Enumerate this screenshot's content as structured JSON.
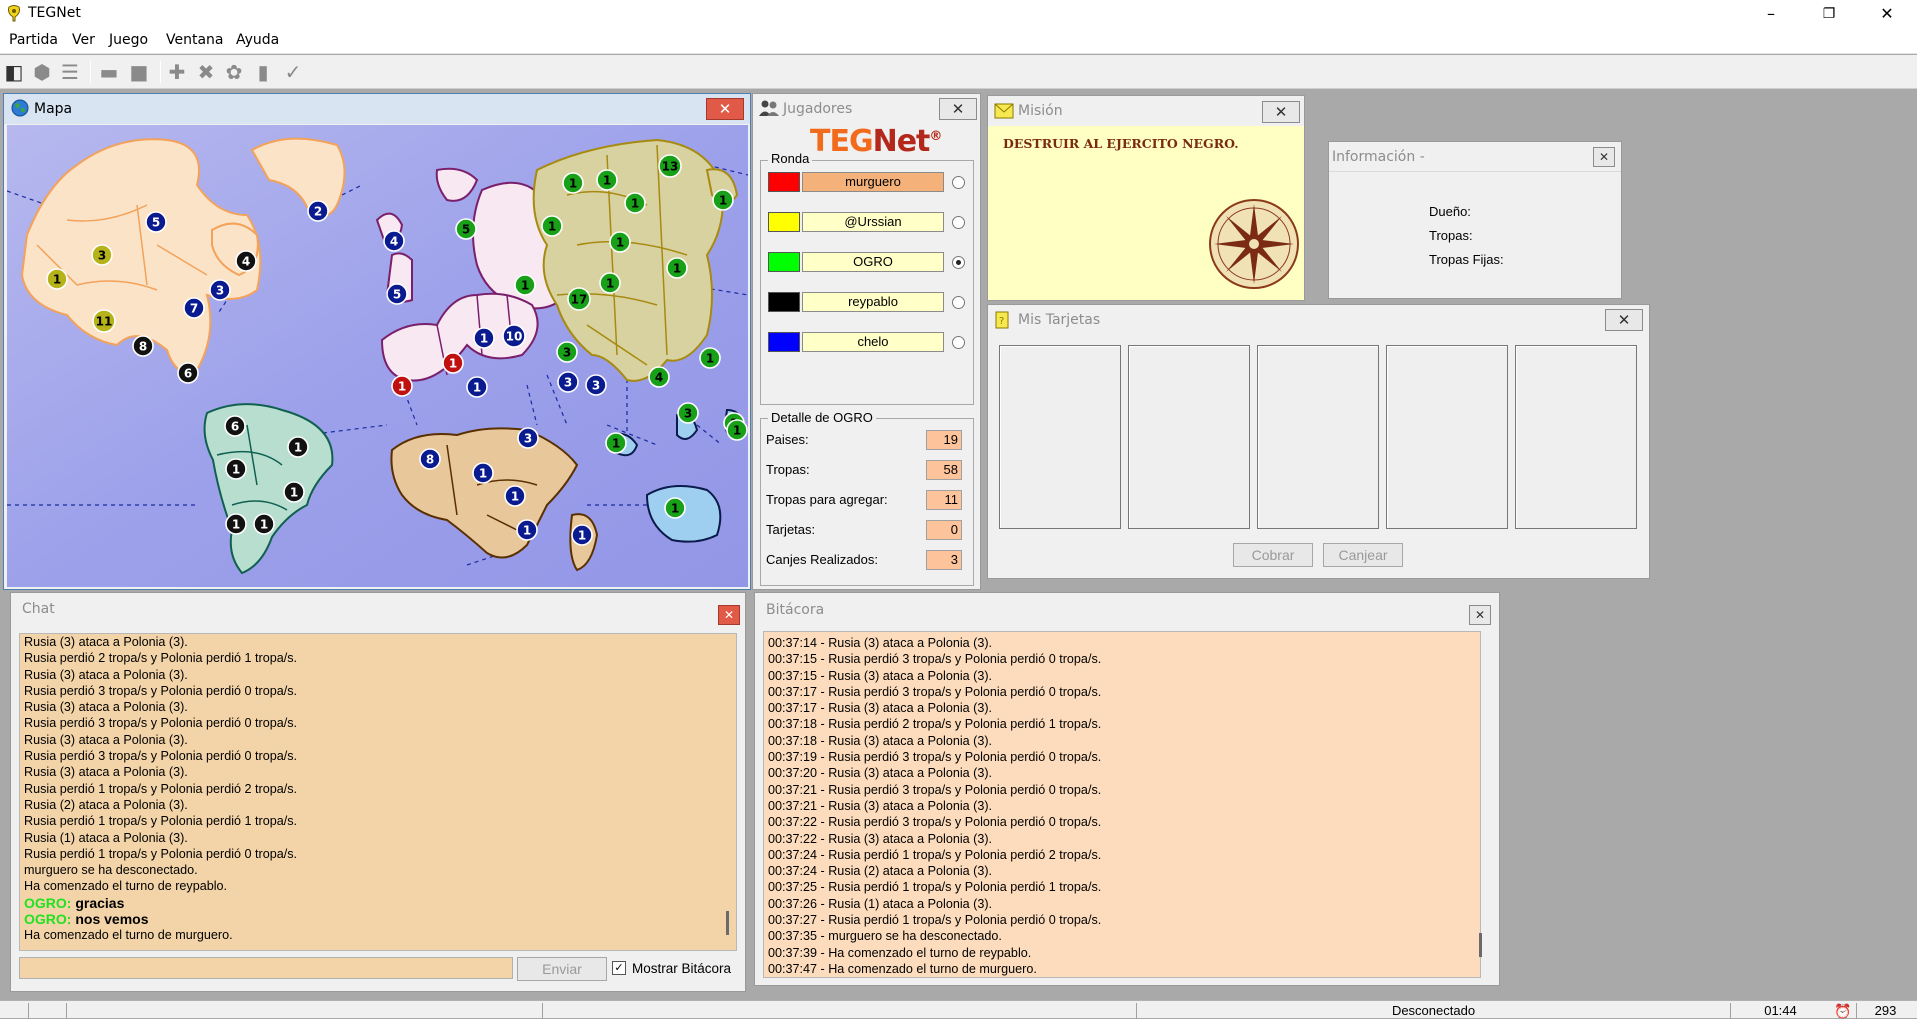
{
  "window": {
    "title": "TEGNet",
    "min": "–",
    "max": "❐",
    "close": "✕"
  },
  "menu": [
    "Partida",
    "Ver",
    "Juego",
    "Ventana",
    "Ayuda"
  ],
  "toolbar": {
    "icons": [
      "connect-icon",
      "start-icon",
      "list-icon",
      "flag-icon",
      "stop-icon",
      "add-army-icon",
      "attack-icon",
      "regroup-icon",
      "card-icon",
      "end-turn-icon"
    ]
  },
  "map_panel": {
    "title": "Mapa",
    "close": "✕"
  },
  "map": {
    "armies": [
      {
        "n": "5",
        "c": "#0a1a8f",
        "fg": "#fff"
      },
      {
        "n": "2",
        "c": "#0a1a8f",
        "fg": "#fff"
      },
      {
        "n": "3",
        "c": "#b6b31a",
        "fg": "#000"
      },
      {
        "n": "4",
        "c": "#111",
        "fg": "#fff"
      },
      {
        "n": "1",
        "c": "#b6b31a",
        "fg": "#000"
      },
      {
        "n": "3",
        "c": "#0a1a8f",
        "fg": "#fff"
      },
      {
        "n": "7",
        "c": "#0a1a8f",
        "fg": "#fff"
      },
      {
        "n": "11",
        "c": "#b6b31a",
        "fg": "#000"
      },
      {
        "n": "8",
        "c": "#111",
        "fg": "#fff"
      },
      {
        "n": "6",
        "c": "#111",
        "fg": "#fff"
      },
      {
        "n": "6",
        "c": "#111",
        "fg": "#fff"
      },
      {
        "n": "1",
        "c": "#111",
        "fg": "#fff"
      },
      {
        "n": "1",
        "c": "#111",
        "fg": "#fff"
      },
      {
        "n": "1",
        "c": "#111",
        "fg": "#fff"
      },
      {
        "n": "1",
        "c": "#111",
        "fg": "#fff"
      },
      {
        "n": "1",
        "c": "#111",
        "fg": "#fff"
      },
      {
        "n": "4",
        "c": "#0a1a8f",
        "fg": "#fff"
      },
      {
        "n": "5",
        "c": "#0a1a8f",
        "fg": "#fff"
      },
      {
        "n": "5",
        "c": "#18a018",
        "fg": "#000"
      },
      {
        "n": "1",
        "c": "#0a1a8f",
        "fg": "#fff"
      },
      {
        "n": "10",
        "c": "#0a1a8f",
        "fg": "#fff"
      },
      {
        "n": "1",
        "c": "#c01010",
        "fg": "#fff"
      },
      {
        "n": "1",
        "c": "#c01010",
        "fg": "#fff"
      },
      {
        "n": "1",
        "c": "#0a1a8f",
        "fg": "#fff"
      },
      {
        "n": "1",
        "c": "#18a018",
        "fg": "#000"
      },
      {
        "n": "1",
        "c": "#18a018",
        "fg": "#000"
      },
      {
        "n": "1",
        "c": "#18a018",
        "fg": "#000"
      },
      {
        "n": "13",
        "c": "#18a018",
        "fg": "#000"
      },
      {
        "n": "1",
        "c": "#18a018",
        "fg": "#000"
      },
      {
        "n": "1",
        "c": "#18a018",
        "fg": "#000"
      },
      {
        "n": "1",
        "c": "#18a018",
        "fg": "#000"
      },
      {
        "n": "1",
        "c": "#18a018",
        "fg": "#000"
      },
      {
        "n": "1",
        "c": "#18a018",
        "fg": "#000"
      },
      {
        "n": "1",
        "c": "#18a018",
        "fg": "#000"
      },
      {
        "n": "17",
        "c": "#18a018",
        "fg": "#000"
      },
      {
        "n": "3",
        "c": "#18a018",
        "fg": "#000"
      },
      {
        "n": "3",
        "c": "#0a1a8f",
        "fg": "#fff"
      },
      {
        "n": "3",
        "c": "#0a1a8f",
        "fg": "#fff"
      },
      {
        "n": "4",
        "c": "#18a018",
        "fg": "#000"
      },
      {
        "n": "1",
        "c": "#18a018",
        "fg": "#000"
      },
      {
        "n": "1",
        "c": "#18a018",
        "fg": "#000"
      },
      {
        "n": "8",
        "c": "#0a1a8f",
        "fg": "#fff"
      },
      {
        "n": "3",
        "c": "#0a1a8f",
        "fg": "#fff"
      },
      {
        "n": "1",
        "c": "#0a1a8f",
        "fg": "#fff"
      },
      {
        "n": "1",
        "c": "#0a1a8f",
        "fg": "#fff"
      },
      {
        "n": "1",
        "c": "#0a1a8f",
        "fg": "#fff"
      },
      {
        "n": "1",
        "c": "#0a1a8f",
        "fg": "#fff"
      },
      {
        "n": "3",
        "c": "#18a018",
        "fg": "#000"
      },
      {
        "n": "1",
        "c": "#18a018",
        "fg": "#000"
      },
      {
        "n": "1",
        "c": "#18a018",
        "fg": "#000"
      },
      {
        "n": "1",
        "c": "#18a018",
        "fg": "#000"
      }
    ]
  },
  "players_panel": {
    "title": "Jugadores",
    "close": "✕",
    "logo_a": "TEG",
    "logo_b": "Net",
    "logo_reg": "®",
    "round_label": "Ronda",
    "players": [
      {
        "name": "murguero",
        "color": "#ff0000",
        "current": true,
        "selected": false
      },
      {
        "name": "@Urssian",
        "color": "#ffff00",
        "current": false,
        "selected": false
      },
      {
        "name": "OGRO",
        "color": "#00ff00",
        "current": false,
        "selected": true
      },
      {
        "name": "reypablo",
        "color": "#000000",
        "current": false,
        "selected": false
      },
      {
        "name": "chelo",
        "color": "#0000ff",
        "current": false,
        "selected": false
      }
    ],
    "detail_title": "Detalle de OGRO",
    "details": [
      {
        "label": "Paises:",
        "value": "19"
      },
      {
        "label": "Tropas:",
        "value": "58"
      },
      {
        "label": "Tropas para agregar:",
        "value": "11"
      },
      {
        "label": "Tarjetas:",
        "value": "0"
      },
      {
        "label": "Canjes Realizados:",
        "value": "3"
      }
    ]
  },
  "mission_panel": {
    "title": "Misión",
    "close": "✕",
    "text": "DESTRUIR AL EJERCITO NEGRO."
  },
  "info_panel": {
    "title": "Información -",
    "close": "✕",
    "owner_label": "Dueño:",
    "troops_label": "Tropas:",
    "fixed_label": "Tropas Fijas:"
  },
  "cards_panel": {
    "title": "Mis Tarjetas",
    "close": "✕",
    "collect": "Cobrar",
    "exchange": "Canjear"
  },
  "chat_panel": {
    "title": "Chat",
    "close": "✕",
    "lines": [
      "Rusia (3) ataca a Polonia (3).",
      "Rusia perdió 2 tropa/s y Polonia perdió 1 tropa/s.",
      "Rusia (3) ataca a Polonia (3).",
      "Rusia perdió 3 tropa/s y Polonia perdió 0 tropa/s.",
      "Rusia (3) ataca a Polonia (3).",
      "Rusia perdió 3 tropa/s y Polonia perdió 0 tropa/s.",
      "Rusia (3) ataca a Polonia (3).",
      "Rusia perdió 3 tropa/s y Polonia perdió 0 tropa/s.",
      "Rusia (3) ataca a Polonia (3).",
      "Rusia perdió 1 tropa/s y Polonia perdió 2 tropa/s.",
      "Rusia (2) ataca a Polonia (3).",
      "Rusia perdió 1 tropa/s y Polonia perdió 1 tropa/s.",
      "Rusia (1) ataca a Polonia (3).",
      "Rusia perdió 1 tropa/s y Polonia perdió 0 tropa/s.",
      "murguero se ha desconectado.",
      "Ha comenzado el turno de reypablo."
    ],
    "messages": [
      {
        "user": "OGRO:",
        "text": "gracias"
      },
      {
        "user": "OGRO:",
        "text": "nos vemos"
      }
    ],
    "last_line": "Ha comenzado el turno de murguero.",
    "input_value": "",
    "send": "Enviar",
    "show_log": "Mostrar Bitácora",
    "show_log_checked": true
  },
  "log_panel": {
    "title": "Bitácora",
    "close": "✕",
    "lines": [
      "00:37:14 - Rusia (3) ataca a Polonia (3).",
      "00:37:15 - Rusia perdió 3 tropa/s y Polonia perdió 0 tropa/s.",
      "00:37:15 - Rusia (3) ataca a Polonia (3).",
      "00:37:17 - Rusia perdió 3 tropa/s y Polonia perdió 0 tropa/s.",
      "00:37:17 - Rusia (3) ataca a Polonia (3).",
      "00:37:18 - Rusia perdió 2 tropa/s y Polonia perdió 1 tropa/s.",
      "00:37:18 - Rusia (3) ataca a Polonia (3).",
      "00:37:19 - Rusia perdió 3 tropa/s y Polonia perdió 0 tropa/s.",
      "00:37:20 - Rusia (3) ataca a Polonia (3).",
      "00:37:21 - Rusia perdió 3 tropa/s y Polonia perdió 0 tropa/s.",
      "00:37:21 - Rusia (3) ataca a Polonia (3).",
      "00:37:22 - Rusia perdió 3 tropa/s y Polonia perdió 0 tropa/s.",
      "00:37:22 - Rusia (3) ataca a Polonia (3).",
      "00:37:24 - Rusia perdió 1 tropa/s y Polonia perdió 2 tropa/s.",
      "00:37:24 - Rusia (2) ataca a Polonia (3).",
      "00:37:25 - Rusia perdió 1 tropa/s y Polonia perdió 1 tropa/s.",
      "00:37:26 - Rusia (1) ataca a Polonia (3).",
      "00:37:27 - Rusia perdió 1 tropa/s y Polonia perdió 0 tropa/s.",
      "00:37:35 - murguero se ha desconectado.",
      "00:37:39 - Ha comenzado el turno de reypablo.",
      "00:37:47 - Ha comenzado el turno de murguero."
    ]
  },
  "statusbar": {
    "connection": "Desconectado",
    "time": "01:44",
    "counter": "293"
  }
}
